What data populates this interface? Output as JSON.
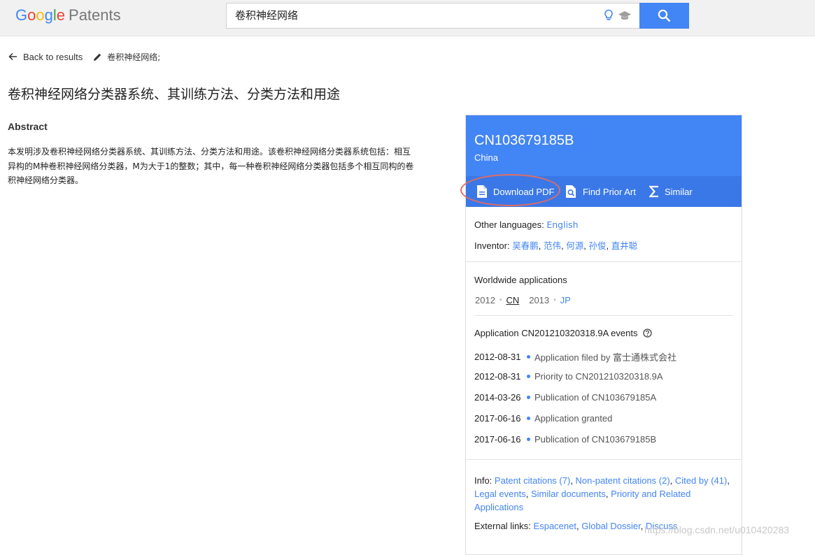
{
  "header": {
    "logo_text": "Google",
    "logo_product": "Patents",
    "search_value": "卷积神经网络"
  },
  "subnav": {
    "back_label": "Back to results",
    "query_label": "卷积神经网络;"
  },
  "patent": {
    "title": "卷积神经网络分类器系统、其训练方法、分类方法和用途",
    "abstract_heading": "Abstract",
    "abstract_text": "本发明涉及卷积神经网络分类器系统、其训练方法、分类方法和用途。该卷积神经网络分类器系统包括：相互异构的M种卷积神经网络分类器，M为大于1的整数；其中，每一种卷积神经网络分类器包括多个相互同构的卷积神经网络分类器。"
  },
  "card": {
    "pub_number": "CN103679185B",
    "country": "China",
    "actions": {
      "download_pdf": "Download PDF",
      "find_prior_art": "Find Prior Art",
      "similar": "Similar"
    },
    "other_languages_label": "Other languages:",
    "other_languages_value": "English",
    "inventor_label": "Inventor:",
    "inventors": [
      "吴春鹏",
      "范伟",
      "何源",
      "孙俊",
      "直井聪"
    ],
    "worldwide_heading": "Worldwide applications",
    "worldwide": {
      "year1": "2012",
      "country1": "CN",
      "year2": "2013",
      "country2": "JP"
    },
    "events_heading": "Application CN201210320318.9A events",
    "events": [
      {
        "date": "2012-08-31",
        "text": "Application filed by 富士通株式会社"
      },
      {
        "date": "2012-08-31",
        "text": "Priority to CN201210320318.9A"
      },
      {
        "date": "2014-03-26",
        "text": "Publication of CN103679185A"
      },
      {
        "date": "2017-06-16",
        "text": "Application granted"
      },
      {
        "date": "2017-06-16",
        "text": "Publication of CN103679185B"
      }
    ],
    "info_label": "Info:",
    "info_links": [
      "Patent citations (7)",
      "Non-patent citations (2)",
      "Cited by (41)",
      "Legal events",
      "Similar documents",
      "Priority and Related Applications"
    ],
    "external_links_label": "External links:",
    "external_links": [
      "Espacenet",
      "Global Dossier",
      "Discuss"
    ]
  },
  "watermark": "https://blog.csdn.net/u010420283",
  "colors": {
    "accent": "#4285f4",
    "card_action_bar": "#3b78e7",
    "annotation": "#e06d63"
  }
}
